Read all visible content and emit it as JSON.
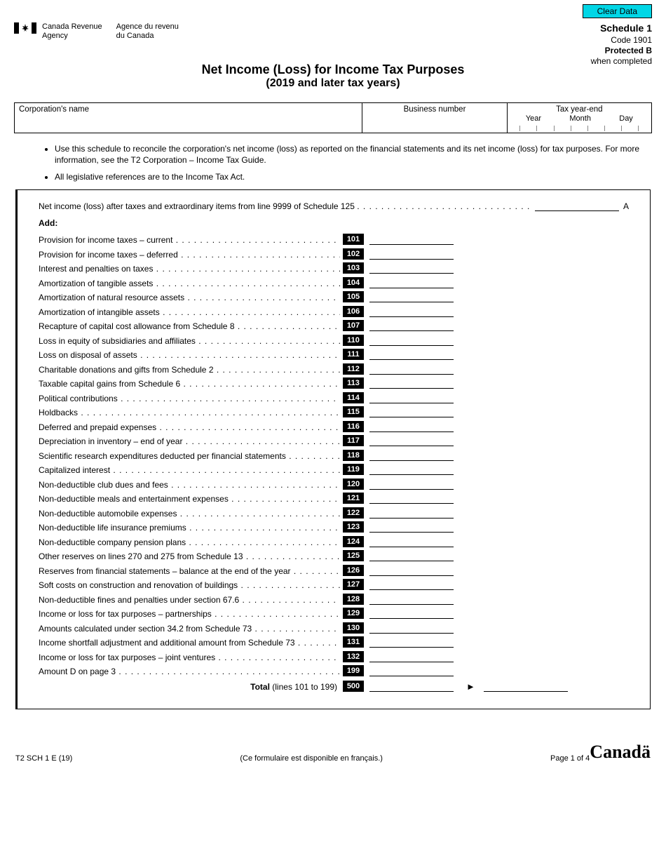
{
  "buttons": {
    "clear_data": "Clear Data"
  },
  "agency": {
    "en_line1": "Canada Revenue",
    "en_line2": "Agency",
    "fr_line1": "Agence du revenu",
    "fr_line2": "du Canada"
  },
  "header_right": {
    "schedule": "Schedule 1",
    "code": "Code 1901",
    "protected": "Protected B",
    "when": "when completed"
  },
  "title": {
    "main": "Net Income (Loss) for Income Tax Purposes",
    "sub": "(2019 and later tax years)"
  },
  "info": {
    "corp_label": "Corporation's name",
    "bn_label": "Business number",
    "tax_label": "Tax year-end",
    "year": "Year",
    "month": "Month",
    "day": "Day"
  },
  "notes": {
    "n1": "Use this schedule to reconcile the corporation's net income (loss) as reported on the financial statements and its net income (loss) for tax purposes. For more information, see the T2 Corporation – Income Tax Guide.",
    "n2": "All legislative references are to the Income Tax Act."
  },
  "line_a": {
    "label": "Net income (loss) after taxes and extraordinary items from line 9999 of Schedule 125",
    "letter": "A"
  },
  "add_label": "Add:",
  "rows": [
    {
      "code": "101",
      "label": "Provision for income taxes – current"
    },
    {
      "code": "102",
      "label": "Provision for income taxes – deferred"
    },
    {
      "code": "103",
      "label": "Interest and penalties on taxes"
    },
    {
      "code": "104",
      "label": "Amortization of tangible assets"
    },
    {
      "code": "105",
      "label": "Amortization of natural resource assets"
    },
    {
      "code": "106",
      "label": "Amortization of intangible assets"
    },
    {
      "code": "107",
      "label": "Recapture of capital cost allowance from Schedule 8"
    },
    {
      "code": "110",
      "label": "Loss in equity of subsidiaries and affiliates"
    },
    {
      "code": "111",
      "label": "Loss on disposal of assets"
    },
    {
      "code": "112",
      "label": "Charitable donations and gifts from Schedule 2"
    },
    {
      "code": "113",
      "label": "Taxable capital gains from Schedule 6"
    },
    {
      "code": "114",
      "label": "Political contributions"
    },
    {
      "code": "115",
      "label": "Holdbacks"
    },
    {
      "code": "116",
      "label": "Deferred and prepaid expenses"
    },
    {
      "code": "117",
      "label": "Depreciation in inventory – end of year"
    },
    {
      "code": "118",
      "label": "Scientific research expenditures deducted per financial statements"
    },
    {
      "code": "119",
      "label": "Capitalized interest"
    },
    {
      "code": "120",
      "label": "Non-deductible club dues and fees"
    },
    {
      "code": "121",
      "label": "Non-deductible meals and entertainment expenses"
    },
    {
      "code": "122",
      "label": "Non-deductible automobile expenses"
    },
    {
      "code": "123",
      "label": "Non-deductible life insurance premiums"
    },
    {
      "code": "124",
      "label": "Non-deductible company pension plans"
    },
    {
      "code": "125",
      "label": "Other reserves on lines 270 and 275 from Schedule 13"
    },
    {
      "code": "126",
      "label": "Reserves from financial statements – balance at the end of the year"
    },
    {
      "code": "127",
      "label": "Soft costs on construction and renovation of buildings"
    },
    {
      "code": "128",
      "label": "Non-deductible fines and penalties under section 67.6"
    },
    {
      "code": "129",
      "label": "Income or loss for tax purposes – partnerships"
    },
    {
      "code": "130",
      "label": "Amounts calculated under section 34.2 from Schedule 73"
    },
    {
      "code": "131",
      "label": "Income shortfall adjustment and additional amount from Schedule 73"
    },
    {
      "code": "132",
      "label": "Income or loss for tax purposes – joint ventures"
    },
    {
      "code": "199",
      "label": "Amount D on page 3"
    }
  ],
  "total": {
    "bold": "Total",
    "rest": " (lines 101 to 199)",
    "code": "500"
  },
  "footer": {
    "form_id": "T2 SCH 1 E (19)",
    "french": "(Ce formulaire est disponible en français.)",
    "page": "Page 1 of 4",
    "wordmark": "Canadä"
  }
}
